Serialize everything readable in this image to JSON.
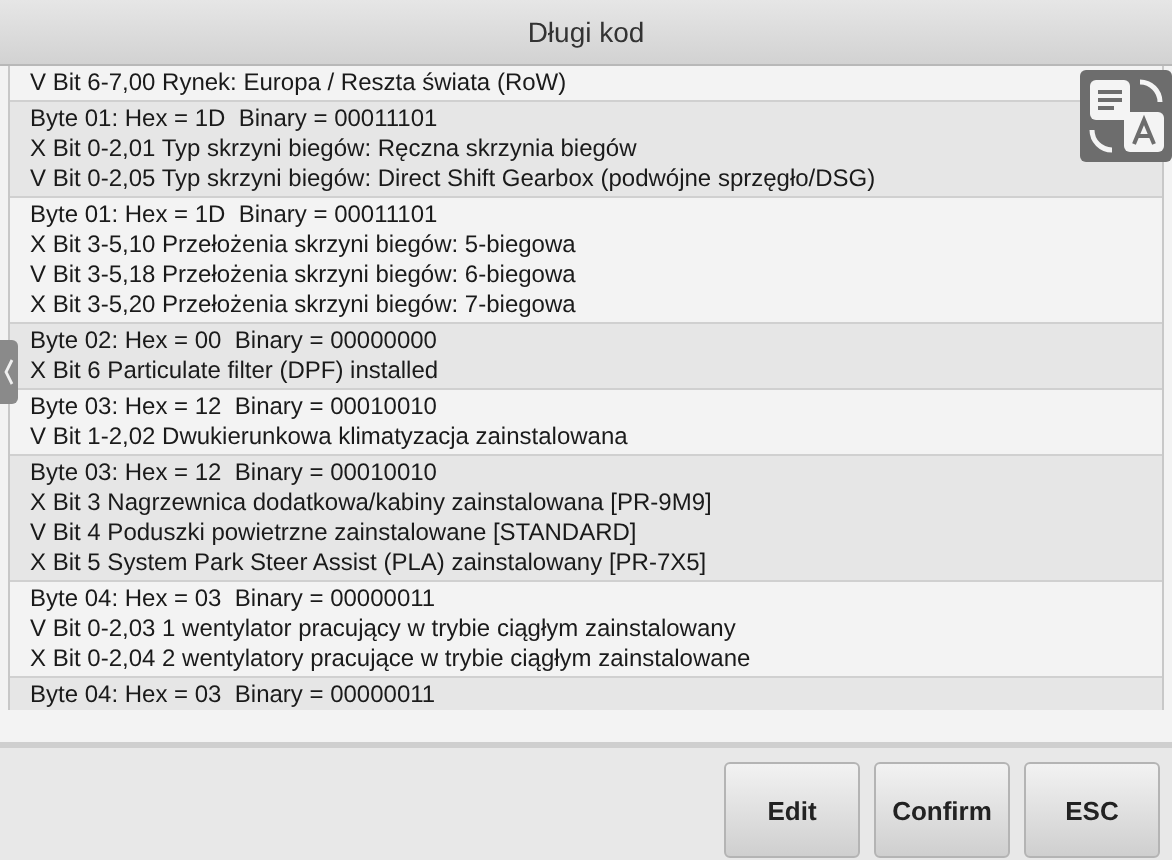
{
  "window": {
    "title": "Długi kod"
  },
  "entries": [
    {
      "lines": [
        "V Bit 6-7,00 Rynek: Europa / Reszta świata (RoW)"
      ]
    },
    {
      "lines": [
        "Byte 01: Hex = 1D  Binary = 00011101",
        "X Bit 0-2,01 Typ skrzyni biegów: Ręczna skrzynia biegów",
        "V Bit 0-2,05 Typ skrzyni biegów: Direct Shift Gearbox (podwójne sprzęgło/DSG)"
      ]
    },
    {
      "lines": [
        "Byte 01: Hex = 1D  Binary = 00011101",
        "X Bit 3-5,10 Przełożenia skrzyni biegów: 5-biegowa",
        "V Bit 3-5,18 Przełożenia skrzyni biegów: 6-biegowa",
        "X Bit 3-5,20 Przełożenia skrzyni biegów: 7-biegowa"
      ]
    },
    {
      "lines": [
        "Byte 02: Hex = 00  Binary = 00000000",
        "X Bit 6 Particulate filter (DPF) installed"
      ]
    },
    {
      "lines": [
        "Byte 03: Hex = 12  Binary = 00010010",
        "V Bit 1-2,02 Dwukierunkowa klimatyzacja zainstalowana"
      ]
    },
    {
      "lines": [
        "Byte 03: Hex = 12  Binary = 00010010",
        "X Bit 3 Nagrzewnica dodatkowa/kabiny zainstalowana [PR-9M9]",
        "V Bit 4 Poduszki powietrzne zainstalowane [STANDARD]",
        "X Bit 5 System Park Steer Assist (PLA) zainstalowany [PR-7X5]"
      ]
    },
    {
      "lines": [
        "Byte 04: Hex = 03  Binary = 00000011",
        "V Bit 0-2,03 1 wentylator pracujący w trybie ciągłym zainstalowany",
        "X Bit 0-2,04 2 wentylatory pracujące w trybie ciągłym zainstalowane"
      ]
    },
    {
      "lines": [
        "Byte 04: Hex = 03  Binary = 00000011"
      ]
    }
  ],
  "buttons": [
    "Edit",
    "Confirm",
    "ESC"
  ]
}
